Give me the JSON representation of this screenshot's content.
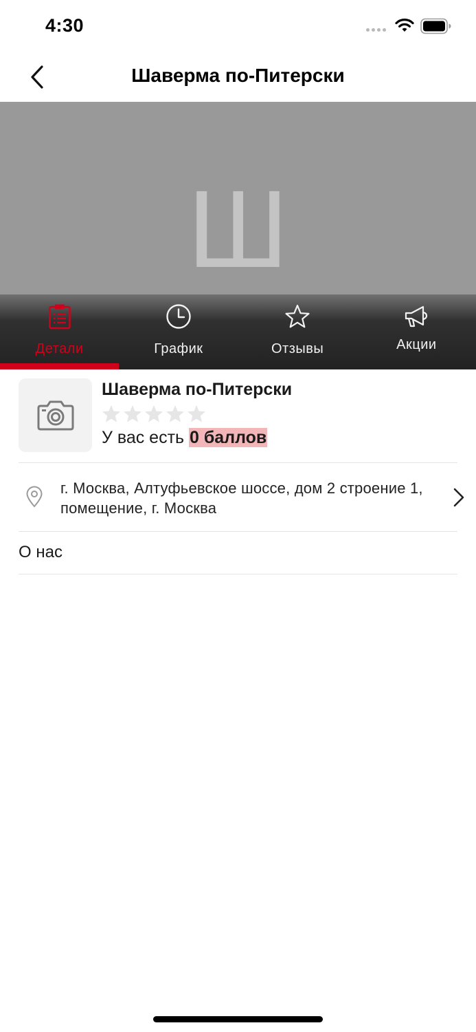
{
  "status_bar": {
    "time": "4:30",
    "icons": [
      "signal-dots",
      "wifi-icon",
      "battery-icon"
    ]
  },
  "nav": {
    "title": "Шаверма по-Питерски",
    "back_icon": "chevron-left-icon"
  },
  "hero": {
    "placeholder_letter": "Ш",
    "background_color": "#999999"
  },
  "tabs": [
    {
      "label": "Детали",
      "icon": "clipboard-icon",
      "active": true
    },
    {
      "label": "График",
      "icon": "clock-icon",
      "active": false
    },
    {
      "label": "Отзывы",
      "icon": "star-icon",
      "active": false
    },
    {
      "label": "Акции",
      "icon": "megaphone-icon",
      "active": false
    }
  ],
  "venue": {
    "name": "Шаверма по-Питерски",
    "rating": 0,
    "rating_max": 5,
    "points_prefix": "У вас есть",
    "points_value": "0 баллов",
    "photo_icon": "camera-icon"
  },
  "address": {
    "text": "г. Москва, Алтуфьевское шоссе, дом 2 строение 1, помещение, г. Москва",
    "icon": "map-pin-icon"
  },
  "about": {
    "label": "О нас"
  },
  "colors": {
    "accent": "#d0021b",
    "points_highlight": "#f3b6b8",
    "star_empty": "#e6e6e6"
  }
}
